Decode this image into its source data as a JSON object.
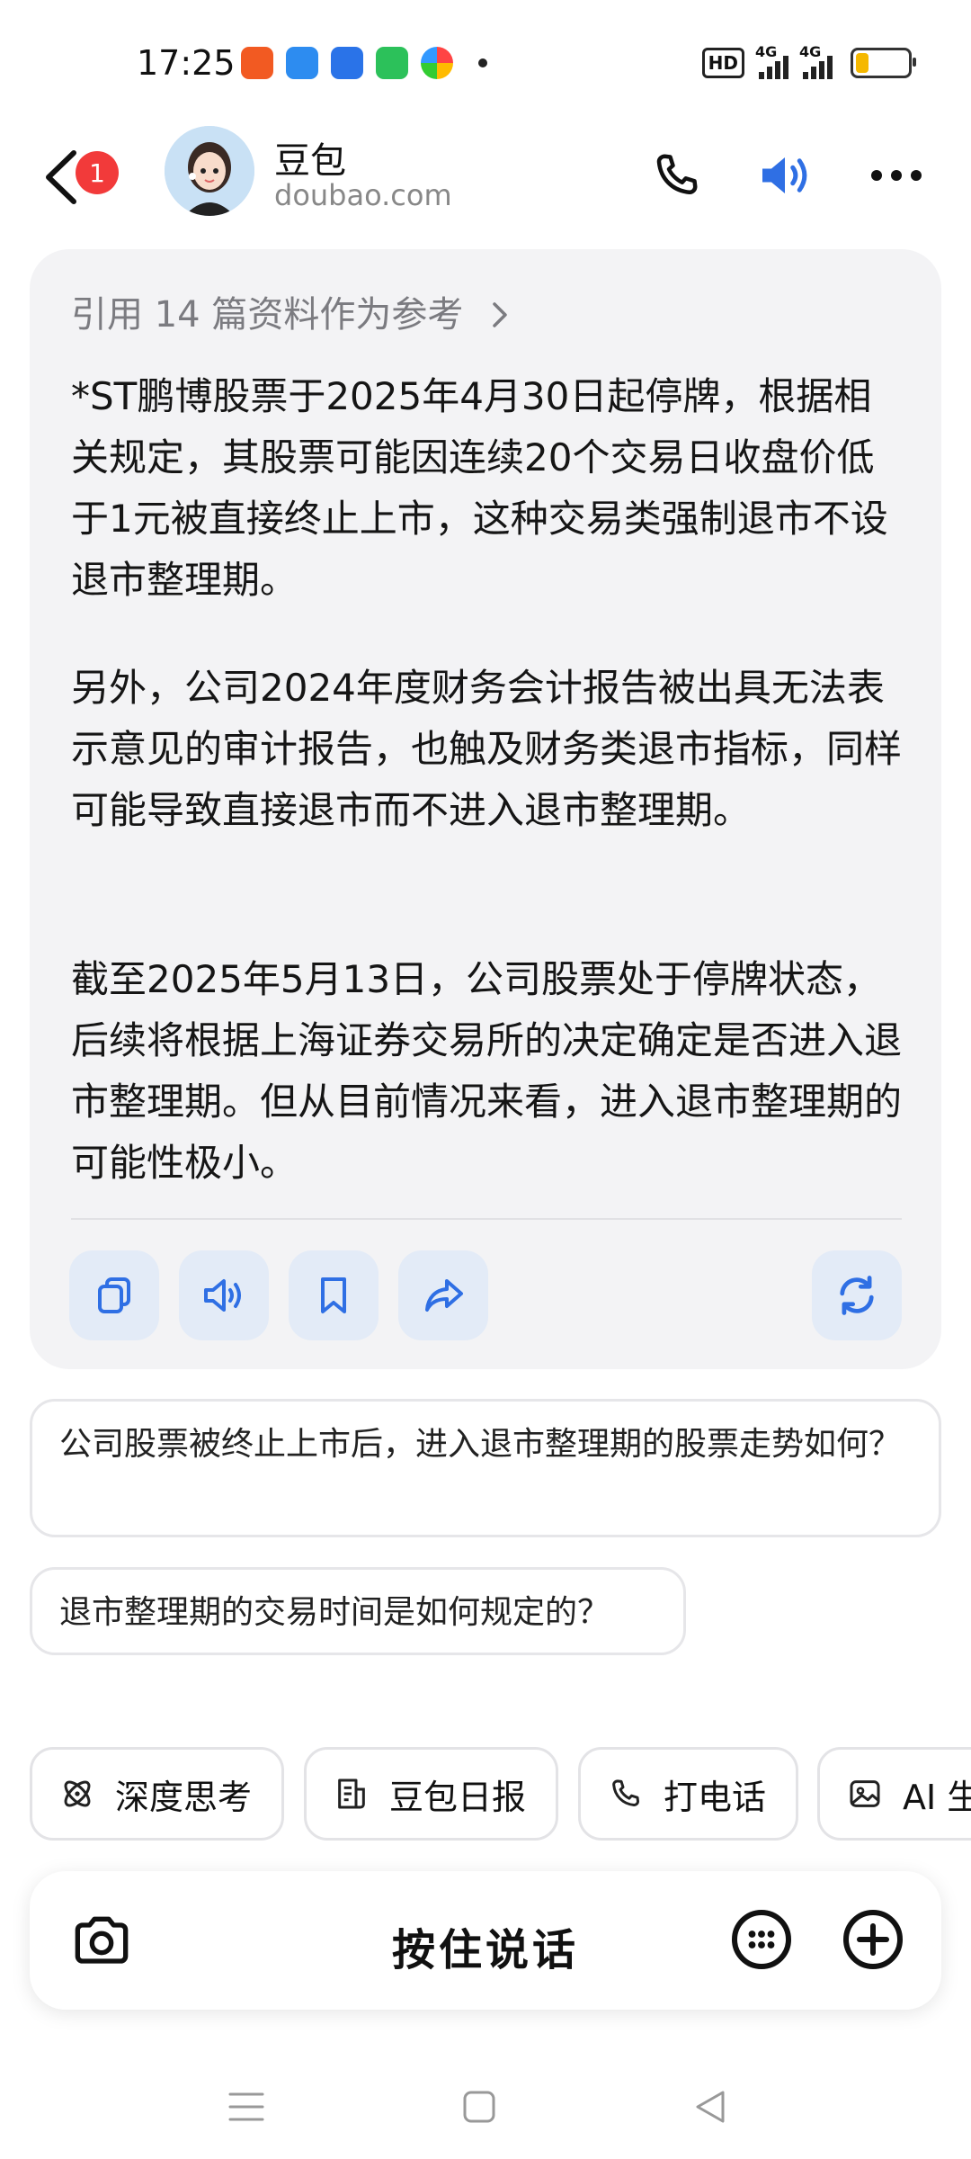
{
  "status_bar": {
    "time": "17:25",
    "hd_label": "HD",
    "network1": "4G",
    "network2": "4G",
    "battery_level": 0.25
  },
  "header": {
    "badge_count": "1",
    "title": "豆包",
    "subtitle": "doubao.com"
  },
  "answer": {
    "reference_text": "引用 14 篇资料作为参考",
    "paragraphs": [
      "*ST鹏博股票于2025年4月30日起停牌，根据相关规定，其股票可能因连续20个交易日收盘价低于1元被直接终止上市，这种交易类强制退市不设退市整理期。",
      "另外，公司2024年度财务会计报告被出具无法表示意见的审计报告，也触及财务类退市指标，同样可能导致直接退市而不进入退市整理期。",
      "截至2025年5月13日，公司股票处于停牌状态，后续将根据上海证券交易所的决定确定是否进入退市整理期。但从目前情况来看，进入退市整理期的可能性极小。"
    ]
  },
  "suggestions": [
    "公司股票被终止上市后，进入退市整理期的股票走势如何？",
    "退市整理期的交易时间是如何规定的？"
  ],
  "chips": [
    {
      "label": "深度思考",
      "icon": "atom-icon"
    },
    {
      "label": "豆包日报",
      "icon": "report-icon"
    },
    {
      "label": "打电话",
      "icon": "phone-icon"
    },
    {
      "label": "AI 生",
      "icon": "image-icon"
    }
  ],
  "input": {
    "hold_to_talk": "按住说话"
  },
  "colors": {
    "accent": "#2f6fe4",
    "badge": "#f23a3a",
    "card_bg": "#f3f3f5"
  }
}
